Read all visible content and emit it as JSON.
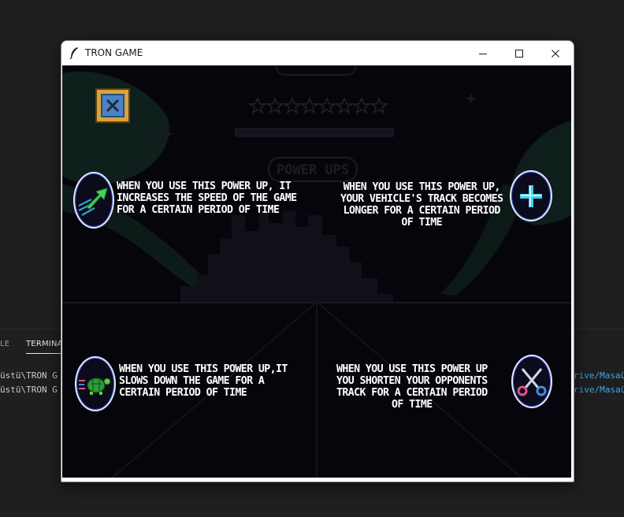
{
  "window": {
    "title": "TRON GAME"
  },
  "ide": {
    "panel_tabs": [
      "LE",
      "TERMINA"
    ],
    "terminal_left": [
      "üstü\\TRON G",
      "üstü\\TRON G"
    ],
    "terminal_right": [
      "rive/Masaü",
      "rive/Masaü"
    ]
  },
  "screen": {
    "exit_icon": "close-x-icon",
    "powerups": [
      {
        "name": "speed",
        "icon": "speed-arrow-icon",
        "text": "WHEN YOU USE THIS POWER UP, IT\nINCREASES THE SPEED OF THE GAME\nFOR A CERTAIN PERIOD OF TIME"
      },
      {
        "name": "longer-track",
        "icon": "plus-icon",
        "text": "WHEN YOU USE THIS POWER UP,\nYOUR VEHICLE'S TRACK BECOMES\nLONGER FOR A CERTAIN PERIOD\nOF TIME"
      },
      {
        "name": "slow",
        "icon": "turtle-icon",
        "text": "WHEN YOU USE THIS POWER UP,IT\nSLOWS DOWN THE GAME FOR A\nCERTAIN PERIOD OF TIME"
      },
      {
        "name": "shorten-track",
        "icon": "scissors-icon",
        "text": "WHEN YOU USE THIS POWER UP\nYOU SHORTEN YOUR OPPONENTS\nTRACK FOR A CERTAIN PERIOD\nOF TIME"
      }
    ]
  },
  "colors": {
    "canvas_bg": "#07050c",
    "exit_frame": "#d7a43c",
    "exit_inner": "#4d83c6",
    "icon_ring": "#dfe7ff",
    "text": "#ffffff"
  }
}
